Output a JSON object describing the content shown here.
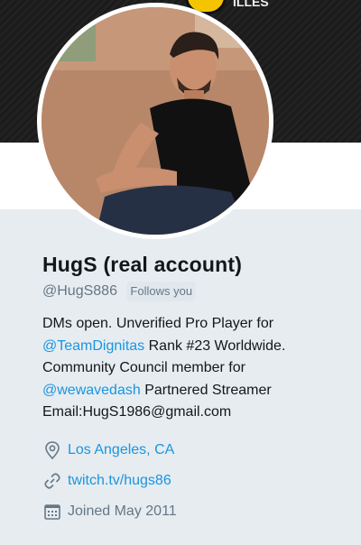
{
  "banner": {
    "text": "ILLES"
  },
  "profile": {
    "display_name": "HugS (real account)",
    "handle": "@HugS886",
    "follows_you": "Follows you",
    "bio": {
      "line1": "DMs open. Unverified Pro Player for",
      "mention1": "@TeamDignitas",
      "line2_rest": " Rank #23 Worldwide.",
      "line3": "Community Council member for",
      "mention2": "@wewavedash",
      "line4_rest": " Partnered Streamer",
      "line5": "Email:HugS1986@gmail.com"
    },
    "location": "Los Angeles, CA",
    "website": "twitch.tv/hugs86",
    "joined": "Joined May 2011"
  },
  "icons": {
    "location": "location-pin-icon",
    "link": "link-icon",
    "calendar": "calendar-icon"
  },
  "colors": {
    "link": "#1b95e0",
    "muted": "#657786",
    "background": "#e6ecf0"
  }
}
